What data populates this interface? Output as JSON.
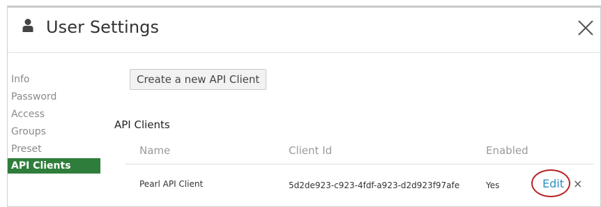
{
  "header": {
    "title": "User Settings",
    "user_icon": "user-icon",
    "close_icon": "close-icon"
  },
  "sidebar": {
    "items": [
      {
        "label": "Info",
        "active": false
      },
      {
        "label": "Password",
        "active": false
      },
      {
        "label": "Access",
        "active": false
      },
      {
        "label": "Groups",
        "active": false
      },
      {
        "label": "Preset",
        "active": false
      },
      {
        "label": "API Clients",
        "active": true
      }
    ]
  },
  "main": {
    "create_button_label": "Create a new API Client",
    "section_title": "API Clients",
    "table": {
      "columns": [
        "Name",
        "Client Id",
        "Enabled"
      ],
      "rows": [
        {
          "name": "Pearl API Client",
          "client_id": "5d2de923-c923-4fdf-a923-d2d923f97afe",
          "enabled": "Yes",
          "edit_label": "Edit",
          "delete_icon": "delete-icon"
        }
      ]
    }
  },
  "colors": {
    "active_item": "#2e7d3a",
    "link": "#2a8fc4",
    "highlight_ring": "#b52121"
  }
}
